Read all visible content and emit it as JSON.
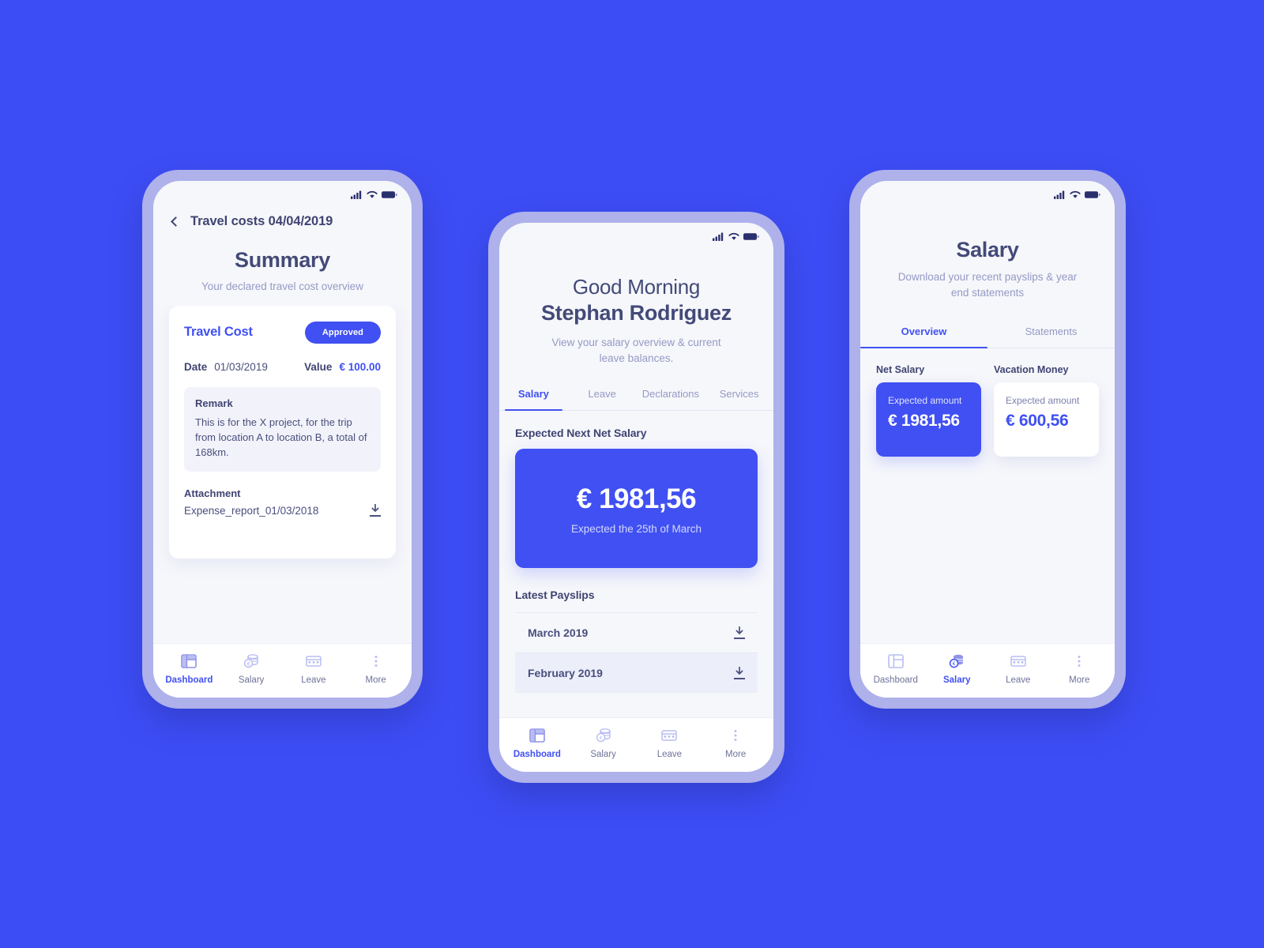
{
  "theme": {
    "background": "#3d4df5",
    "accent": "#4050f2",
    "screen_bg": "#f6f7fb",
    "frame": "#aeb1ea",
    "text_dark": "#3f4472",
    "text_muted": "#9599c4"
  },
  "phone_left": {
    "status": {
      "signal": "signal-icon",
      "wifi": "wifi-icon",
      "battery": "battery-icon"
    },
    "nav": {
      "back": "back-chevron-icon",
      "title": "Travel costs 04/04/2019"
    },
    "header": {
      "title": "Summary",
      "subtitle": "Your declared travel cost overview"
    },
    "card": {
      "heading": "Travel Cost",
      "status_pill": "Approved",
      "date_label": "Date",
      "date_value": "01/03/2019",
      "value_label": "Value",
      "value_amount": "€ 100.00",
      "remark_label": "Remark",
      "remark_text": "This is for the X project, for the trip from location A to location B, a total of 168km.",
      "attachment_label": "Attachment",
      "attachment_name": "Expense_report_01/03/2018",
      "download_icon": "download-icon"
    },
    "bottom_nav": [
      {
        "label": "Dashboard",
        "icon": "dashboard-icon",
        "active": true
      },
      {
        "label": "Salary",
        "icon": "coins-euro-icon",
        "active": false
      },
      {
        "label": "Leave",
        "icon": "calendar-card-icon",
        "active": false
      },
      {
        "label": "More",
        "icon": "more-dots-icon",
        "active": false
      }
    ]
  },
  "phone_center": {
    "status": {
      "signal": "signal-icon",
      "wifi": "wifi-icon",
      "battery": "battery-icon"
    },
    "header": {
      "greeting": "Good Morning",
      "name": "Stephan Rodriguez",
      "subtitle": "View your salary overview & current leave balances."
    },
    "tabs": [
      {
        "label": "Salary",
        "active": true
      },
      {
        "label": "Leave",
        "active": false
      },
      {
        "label": "Declarations",
        "active": false
      },
      {
        "label": "Services",
        "active": false
      }
    ],
    "expected": {
      "section_title": "Expected Next Net Salary",
      "amount": "€ 1981,56",
      "note": "Expected the 25th of March"
    },
    "payslips": {
      "section_title": "Latest Payslips",
      "items": [
        {
          "label": "March 2019",
          "icon": "download-icon"
        },
        {
          "label": "February 2019",
          "icon": "download-icon"
        }
      ]
    },
    "bottom_nav": [
      {
        "label": "Dashboard",
        "icon": "dashboard-icon",
        "active": true
      },
      {
        "label": "Salary",
        "icon": "coins-euro-icon",
        "active": false
      },
      {
        "label": "Leave",
        "icon": "calendar-card-icon",
        "active": false
      },
      {
        "label": "More",
        "icon": "more-dots-icon",
        "active": false
      }
    ]
  },
  "phone_right": {
    "status": {
      "signal": "signal-icon",
      "wifi": "wifi-icon",
      "battery": "battery-icon"
    },
    "header": {
      "title": "Salary",
      "subtitle": "Download your recent payslips & year end statements"
    },
    "tabs": [
      {
        "label": "Overview",
        "active": true
      },
      {
        "label": "Statements",
        "active": false
      }
    ],
    "cards": [
      {
        "label": "Net Salary",
        "sub": "Expected amount",
        "amount": "€ 1981,56",
        "style": "filled"
      },
      {
        "label": "Vacation Money",
        "sub": "Expected amount",
        "amount": "€ 600,56",
        "style": "plain"
      }
    ],
    "bottom_nav": [
      {
        "label": "Dashboard",
        "icon": "dashboard-icon",
        "active": false
      },
      {
        "label": "Salary",
        "icon": "coins-euro-icon",
        "active": true
      },
      {
        "label": "Leave",
        "icon": "calendar-card-icon",
        "active": false
      },
      {
        "label": "More",
        "icon": "more-dots-icon",
        "active": false
      }
    ]
  }
}
